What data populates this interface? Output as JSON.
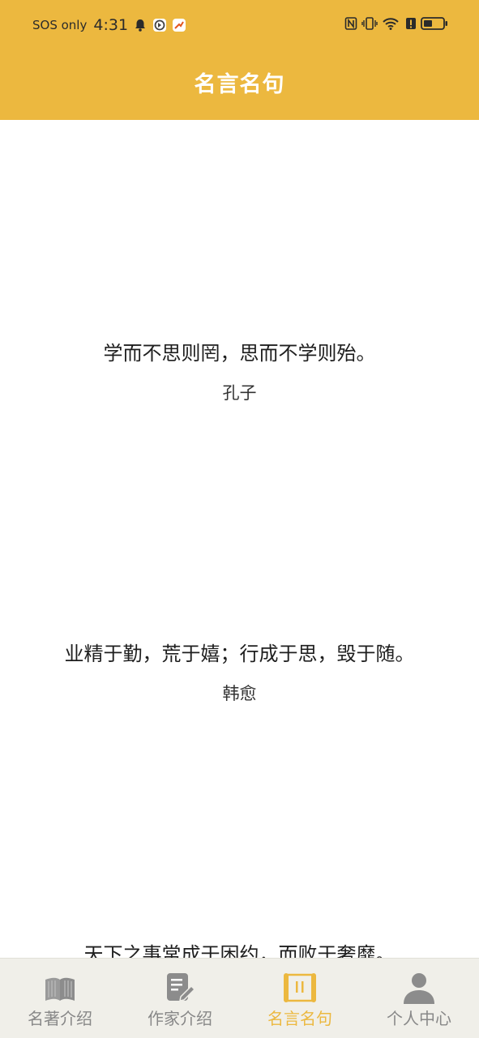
{
  "status_bar": {
    "network": "SOS only",
    "time": "4:31",
    "icons": [
      "bell-icon",
      "app-icon-1",
      "app-icon-2",
      "nfc-icon",
      "vibrate-icon",
      "wifi-icon",
      "alert-icon",
      "battery-icon"
    ]
  },
  "header": {
    "title": "名言名句"
  },
  "quotes": [
    {
      "text": "学而不思则罔，思而不学则殆。",
      "author": "孔子"
    },
    {
      "text": "业精于勤，荒于嬉；行成于思，毁于随。",
      "author": "韩愈"
    },
    {
      "text": "天下之事常成于困约，而败于奢靡。",
      "author": ""
    }
  ],
  "tabs": [
    {
      "label": "名著介绍",
      "icon": "book-icon",
      "active": false
    },
    {
      "label": "作家介绍",
      "icon": "document-edit-icon",
      "active": false
    },
    {
      "label": "名言名句",
      "icon": "scroll-icon",
      "active": true
    },
    {
      "label": "个人中心",
      "icon": "person-icon",
      "active": false
    }
  ],
  "colors": {
    "accent": "#ecb83f",
    "tab_inactive": "#888888",
    "tab_bar_bg": "#f0efe9"
  }
}
